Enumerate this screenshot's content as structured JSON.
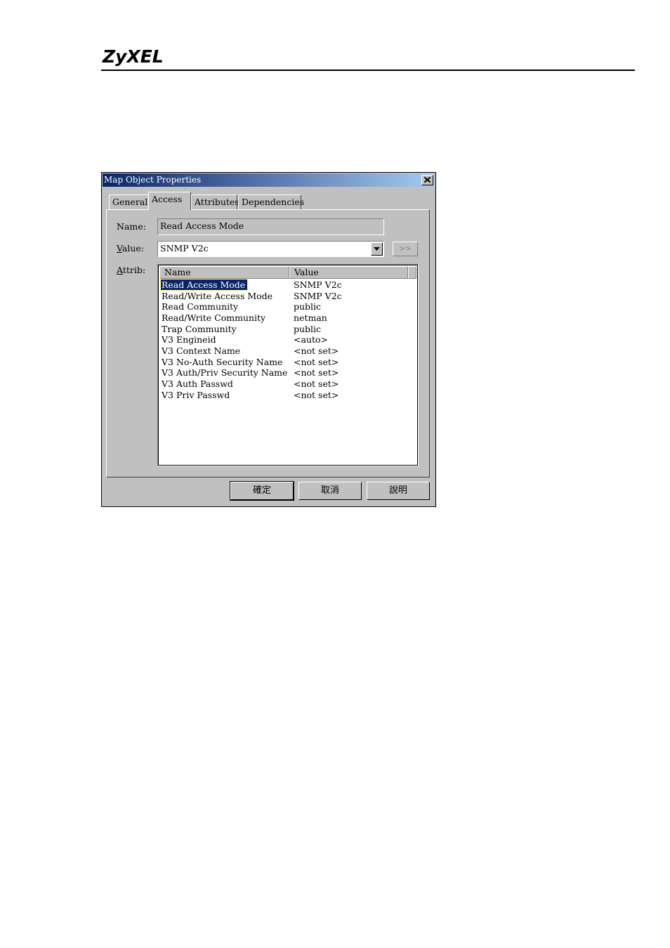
{
  "header": {
    "logo": "ZyXEL"
  },
  "dialog": {
    "title": "Map Object Properties",
    "tabs": [
      {
        "label": "General"
      },
      {
        "label": "Access"
      },
      {
        "label": "Attributes"
      },
      {
        "label": "Dependencies"
      }
    ],
    "active_tab": "Access",
    "name_label": "Name:",
    "name_value": "Read Access Mode",
    "value_label_mn": "V",
    "value_label_rest": "alue:",
    "value_selected": "SNMP V2c",
    "more_button": ">>",
    "attrib_label_mn": "A",
    "attrib_label_rest": "ttrib:",
    "columns": [
      "Name",
      "Value"
    ],
    "rows": [
      {
        "name": "Read Access Mode",
        "value": "SNMP V2c"
      },
      {
        "name": "Read/Write Access Mode",
        "value": "SNMP V2c"
      },
      {
        "name": "Read Community",
        "value": "public"
      },
      {
        "name": "Read/Write Community",
        "value": "netman"
      },
      {
        "name": "Trap Community",
        "value": "public"
      },
      {
        "name": "V3 Engineid",
        "value": "<auto>"
      },
      {
        "name": "V3 Context Name",
        "value": "<not set>"
      },
      {
        "name": "V3 No-Auth Security Name",
        "value": "<not set>"
      },
      {
        "name": "V3 Auth/Priv Security Name",
        "value": "<not set>"
      },
      {
        "name": "V3 Auth Passwd",
        "value": "<not set>"
      },
      {
        "name": "V3 Priv Passwd",
        "value": "<not set>"
      }
    ],
    "selected_row": 0,
    "buttons": {
      "ok": "確定",
      "cancel": "取消",
      "help": "說明"
    },
    "colors": {
      "titlebar": "#0a246a",
      "face": "#c0c0c0",
      "selection": "#0a246a"
    }
  }
}
